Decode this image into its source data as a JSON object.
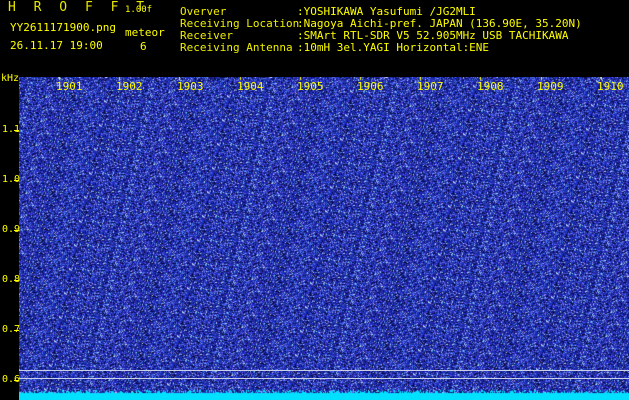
{
  "header": {
    "app_name": "H R O F F T",
    "version": "1.00f",
    "filename": "YY2611171900.png",
    "datetime": "26.11.17 19:00",
    "mode_label": "meteor",
    "count": "6"
  },
  "info": [
    {
      "label": "Overver",
      "value": ":YOSHIKAWA Yasufumi /JG2MLI"
    },
    {
      "label": "Receiving Location",
      "value": ":Nagoya Aichi-pref. JAPAN (136.90E, 35.20N)"
    },
    {
      "label": "Receiver",
      "value": ":SMArt RTL-SDR V5 52.905MHz USB TACHIKAWA"
    },
    {
      "label": "Receiving Antenna",
      "value": ":10mH 3el.YAGI Horizontal:ENE"
    }
  ],
  "axis": {
    "unit": "kHz",
    "y_labels": [
      "1.1",
      "1.0",
      "0.9",
      "0.8",
      "0.7",
      "0.6"
    ],
    "x_labels": [
      "1901",
      "1902",
      "1903",
      "1904",
      "1905",
      "1906",
      "1907",
      "1908",
      "1909",
      "1910"
    ]
  },
  "colors": {
    "background": "#000000",
    "text": "#ffff00",
    "noise_base": "#1a2a9a",
    "noise_bright": "#6a7ae8",
    "baseline": "#00e0ff"
  }
}
